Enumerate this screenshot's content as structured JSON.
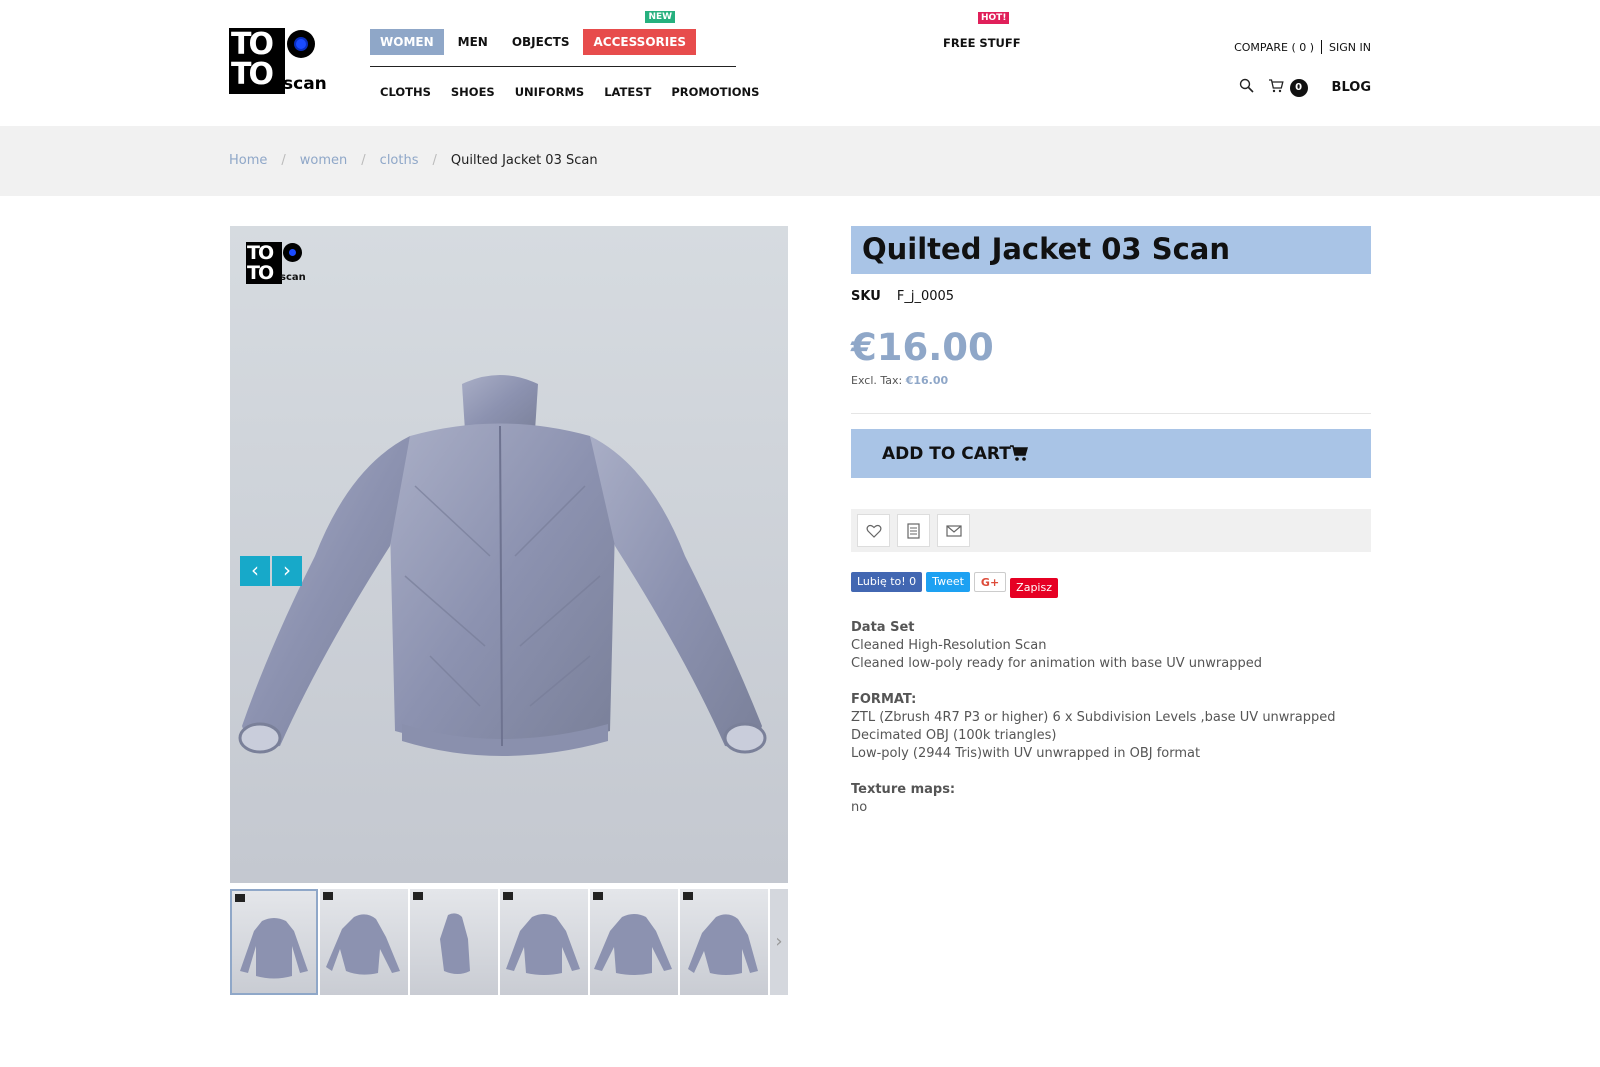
{
  "logo": {
    "line1": "TO",
    "line2": "TO",
    "suffix": "scan"
  },
  "nav": {
    "top": [
      {
        "label": "WOMEN"
      },
      {
        "label": "MEN"
      },
      {
        "label": "OBJECTS"
      },
      {
        "label": "ACCESSORIES",
        "badge": "NEW"
      }
    ],
    "sub": [
      {
        "label": "CLOTHS"
      },
      {
        "label": "SHOES"
      },
      {
        "label": "UNIFORMS"
      },
      {
        "label": "LATEST"
      },
      {
        "label": "PROMOTIONS"
      }
    ],
    "free_stuff": "FREE STUFF",
    "free_badge": "HOT!",
    "compare": "COMPARE ( 0 )",
    "sign_in": "SIGN IN",
    "cart_count": "0",
    "blog": "BLOG"
  },
  "breadcrumb": [
    "Home",
    "women",
    "cloths",
    "Quilted Jacket 03 Scan"
  ],
  "product": {
    "title": "Quilted Jacket 03 Scan",
    "sku_label": "SKU",
    "sku": "F_j_0005",
    "price": "€16.00",
    "excl_label": "Excl. Tax:",
    "excl_price": "€16.00",
    "add_to_cart": "ADD TO CART"
  },
  "social": {
    "fb": "Lubię to! 0",
    "tweet": "Tweet",
    "gplus": "G+",
    "pin": "Zapisz"
  },
  "description": {
    "data_set_title": "Data Set",
    "data_set": [
      "Cleaned High-Resolution Scan",
      "Cleaned low-poly ready for animation with base UV unwrapped"
    ],
    "format_title": "FORMAT:",
    "format": [
      "ZTL (Zbrush 4R7 P3 or higher) 6 x Subdivision Levels ,base UV unwrapped",
      "Decimated OBJ (100k triangles)",
      "Low-poly (2944 Tris)with UV unwrapped in OBJ format"
    ],
    "texture_title": "Texture maps:",
    "texture": "no"
  },
  "colors": {
    "accent": "#8fa7c8",
    "title_bg": "#a9c4e6",
    "hot": "#e74c4c",
    "arrow": "#17a9c9"
  },
  "icons": [
    "search-icon",
    "cart-icon",
    "heart-icon",
    "document-icon",
    "mail-icon",
    "chevron-left-icon",
    "chevron-right-icon"
  ]
}
